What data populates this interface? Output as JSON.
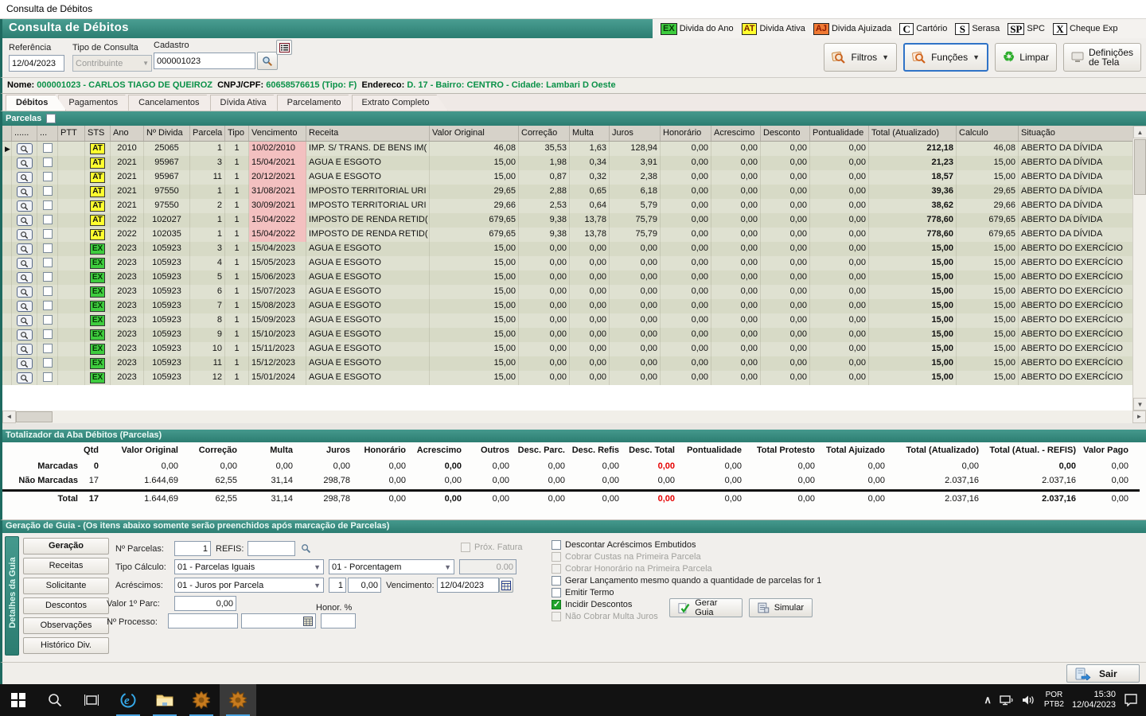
{
  "window": {
    "title": "Consulta de Débitos"
  },
  "header": {
    "title": "Consulta de Débitos",
    "legend": [
      {
        "badge": "EX",
        "label": "Divida do Ano",
        "bg": "#3ecc3e",
        "fg": "#073807",
        "plain": false
      },
      {
        "badge": "AT",
        "label": "Divida Ativa",
        "bg": "#ffff2e",
        "fg": "#7a1e00",
        "plain": false
      },
      {
        "badge": "AJ",
        "label": "Divida Ajuizada",
        "bg": "#f07a34",
        "fg": "#8f1a00",
        "plain": false
      },
      {
        "badge": "C",
        "label": "Cartório",
        "bg": "#ffffff",
        "fg": "#000000",
        "plain": true
      },
      {
        "badge": "S",
        "label": "Serasa",
        "bg": "#ffffff",
        "fg": "#000000",
        "plain": true
      },
      {
        "badge": "SP",
        "label": "SPC",
        "bg": "#ffffff",
        "fg": "#000000",
        "plain": true
      },
      {
        "badge": "X",
        "label": "Cheque Exp",
        "bg": "#ffffff",
        "fg": "#000000",
        "plain": true
      }
    ]
  },
  "filters": {
    "referencia_label": "Referência",
    "referencia_value": "12/04/2023",
    "tipo_consulta_label": "Tipo de Consulta",
    "tipo_consulta_value": "Contribuinte",
    "cadastro_label": "Cadastro",
    "cadastro_value": "000001023",
    "filtros_label": "Filtros",
    "funcoes_label": "Funções",
    "limpar_label": "Limpar",
    "definicoes_label_1": "Definições",
    "definicoes_label_2": "de Tela"
  },
  "taxpayer": {
    "nome_label": "Nome:",
    "nome_value": "000001023 - CARLOS TIAGO DE QUEIROZ",
    "cnpj_label": "CNPJ/CPF:",
    "cnpj_value": "60658576615 (Tipo: F)",
    "endereco_label": "Endereco:",
    "endereco_value": "D. 17 - Bairro: CENTRO - Cidade: Lambari D Oeste"
  },
  "tabs": [
    {
      "label": "Débitos",
      "active": true
    },
    {
      "label": "Pagamentos",
      "active": false
    },
    {
      "label": "Cancelamentos",
      "active": false
    },
    {
      "label": "Dívida Ativa",
      "active": false
    },
    {
      "label": "Parcelamento",
      "active": false
    },
    {
      "label": "Extrato Completo",
      "active": false
    }
  ],
  "parcelas_bar_label": "Parcelas",
  "table": {
    "columns": [
      "......",
      "...",
      "PTT",
      "STS",
      "Ano",
      "Nº Divida",
      "Parcela",
      "Tipo",
      "Vencimento",
      "Receita",
      "Valor Original",
      "Correção",
      "Multa",
      "Juros",
      "Honorário",
      "Acrescimo",
      "Desconto",
      "Pontualidade",
      "Total (Atualizado)",
      "Calculo",
      "Situação"
    ],
    "rows": [
      {
        "sts": "AT",
        "ano": "2010",
        "divida": "25065",
        "parcela": "1",
        "tipo": "1",
        "venc": "10/02/2010",
        "overdue": true,
        "receita": "IMP. S/ TRANS. DE BENS IM(",
        "vo": "46,08",
        "corr": "35,53",
        "multa": "1,63",
        "juros": "128,94",
        "hon": "0,00",
        "acr": "0,00",
        "desc": "0,00",
        "pont": "0,00",
        "total": "212,18",
        "calc": "46,08",
        "sit": "ABERTO DA DÍVIDA"
      },
      {
        "sts": "AT",
        "ano": "2021",
        "divida": "95967",
        "parcela": "3",
        "tipo": "1",
        "venc": "15/04/2021",
        "overdue": true,
        "receita": "AGUA E ESGOTO",
        "vo": "15,00",
        "corr": "1,98",
        "multa": "0,34",
        "juros": "3,91",
        "hon": "0,00",
        "acr": "0,00",
        "desc": "0,00",
        "pont": "0,00",
        "total": "21,23",
        "calc": "15,00",
        "sit": "ABERTO DA DÍVIDA"
      },
      {
        "sts": "AT",
        "ano": "2021",
        "divida": "95967",
        "parcela": "11",
        "tipo": "1",
        "venc": "20/12/2021",
        "overdue": true,
        "receita": "AGUA E ESGOTO",
        "vo": "15,00",
        "corr": "0,87",
        "multa": "0,32",
        "juros": "2,38",
        "hon": "0,00",
        "acr": "0,00",
        "desc": "0,00",
        "pont": "0,00",
        "total": "18,57",
        "calc": "15,00",
        "sit": "ABERTO DA DÍVIDA"
      },
      {
        "sts": "AT",
        "ano": "2021",
        "divida": "97550",
        "parcela": "1",
        "tipo": "1",
        "venc": "31/08/2021",
        "overdue": true,
        "receita": "IMPOSTO TERRITORIAL URI",
        "vo": "29,65",
        "corr": "2,88",
        "multa": "0,65",
        "juros": "6,18",
        "hon": "0,00",
        "acr": "0,00",
        "desc": "0,00",
        "pont": "0,00",
        "total": "39,36",
        "calc": "29,65",
        "sit": "ABERTO DA DÍVIDA"
      },
      {
        "sts": "AT",
        "ano": "2021",
        "divida": "97550",
        "parcela": "2",
        "tipo": "1",
        "venc": "30/09/2021",
        "overdue": true,
        "receita": "IMPOSTO TERRITORIAL URI",
        "vo": "29,66",
        "corr": "2,53",
        "multa": "0,64",
        "juros": "5,79",
        "hon": "0,00",
        "acr": "0,00",
        "desc": "0,00",
        "pont": "0,00",
        "total": "38,62",
        "calc": "29,66",
        "sit": "ABERTO DA DÍVIDA"
      },
      {
        "sts": "AT",
        "ano": "2022",
        "divida": "102027",
        "parcela": "1",
        "tipo": "1",
        "venc": "15/04/2022",
        "overdue": true,
        "receita": "IMPOSTO DE RENDA RETID(",
        "vo": "679,65",
        "corr": "9,38",
        "multa": "13,78",
        "juros": "75,79",
        "hon": "0,00",
        "acr": "0,00",
        "desc": "0,00",
        "pont": "0,00",
        "total": "778,60",
        "calc": "679,65",
        "sit": "ABERTO DA DÍVIDA"
      },
      {
        "sts": "AT",
        "ano": "2022",
        "divida": "102035",
        "parcela": "1",
        "tipo": "1",
        "venc": "15/04/2022",
        "overdue": true,
        "receita": "IMPOSTO DE RENDA RETID(",
        "vo": "679,65",
        "corr": "9,38",
        "multa": "13,78",
        "juros": "75,79",
        "hon": "0,00",
        "acr": "0,00",
        "desc": "0,00",
        "pont": "0,00",
        "total": "778,60",
        "calc": "679,65",
        "sit": "ABERTO DA DÍVIDA"
      },
      {
        "sts": "EX",
        "ano": "2023",
        "divida": "105923",
        "parcela": "3",
        "tipo": "1",
        "venc": "15/04/2023",
        "overdue": false,
        "receita": "AGUA E ESGOTO",
        "vo": "15,00",
        "corr": "0,00",
        "multa": "0,00",
        "juros": "0,00",
        "hon": "0,00",
        "acr": "0,00",
        "desc": "0,00",
        "pont": "0,00",
        "total": "15,00",
        "calc": "15,00",
        "sit": "ABERTO DO EXERCÍCIO"
      },
      {
        "sts": "EX",
        "ano": "2023",
        "divida": "105923",
        "parcela": "4",
        "tipo": "1",
        "venc": "15/05/2023",
        "overdue": false,
        "receita": "AGUA E ESGOTO",
        "vo": "15,00",
        "corr": "0,00",
        "multa": "0,00",
        "juros": "0,00",
        "hon": "0,00",
        "acr": "0,00",
        "desc": "0,00",
        "pont": "0,00",
        "total": "15,00",
        "calc": "15,00",
        "sit": "ABERTO DO EXERCÍCIO"
      },
      {
        "sts": "EX",
        "ano": "2023",
        "divida": "105923",
        "parcela": "5",
        "tipo": "1",
        "venc": "15/06/2023",
        "overdue": false,
        "receita": "AGUA E ESGOTO",
        "vo": "15,00",
        "corr": "0,00",
        "multa": "0,00",
        "juros": "0,00",
        "hon": "0,00",
        "acr": "0,00",
        "desc": "0,00",
        "pont": "0,00",
        "total": "15,00",
        "calc": "15,00",
        "sit": "ABERTO DO EXERCÍCIO"
      },
      {
        "sts": "EX",
        "ano": "2023",
        "divida": "105923",
        "parcela": "6",
        "tipo": "1",
        "venc": "15/07/2023",
        "overdue": false,
        "receita": "AGUA E ESGOTO",
        "vo": "15,00",
        "corr": "0,00",
        "multa": "0,00",
        "juros": "0,00",
        "hon": "0,00",
        "acr": "0,00",
        "desc": "0,00",
        "pont": "0,00",
        "total": "15,00",
        "calc": "15,00",
        "sit": "ABERTO DO EXERCÍCIO"
      },
      {
        "sts": "EX",
        "ano": "2023",
        "divida": "105923",
        "parcela": "7",
        "tipo": "1",
        "venc": "15/08/2023",
        "overdue": false,
        "receita": "AGUA E ESGOTO",
        "vo": "15,00",
        "corr": "0,00",
        "multa": "0,00",
        "juros": "0,00",
        "hon": "0,00",
        "acr": "0,00",
        "desc": "0,00",
        "pont": "0,00",
        "total": "15,00",
        "calc": "15,00",
        "sit": "ABERTO DO EXERCÍCIO"
      },
      {
        "sts": "EX",
        "ano": "2023",
        "divida": "105923",
        "parcela": "8",
        "tipo": "1",
        "venc": "15/09/2023",
        "overdue": false,
        "receita": "AGUA E ESGOTO",
        "vo": "15,00",
        "corr": "0,00",
        "multa": "0,00",
        "juros": "0,00",
        "hon": "0,00",
        "acr": "0,00",
        "desc": "0,00",
        "pont": "0,00",
        "total": "15,00",
        "calc": "15,00",
        "sit": "ABERTO DO EXERCÍCIO"
      },
      {
        "sts": "EX",
        "ano": "2023",
        "divida": "105923",
        "parcela": "9",
        "tipo": "1",
        "venc": "15/10/2023",
        "overdue": false,
        "receita": "AGUA E ESGOTO",
        "vo": "15,00",
        "corr": "0,00",
        "multa": "0,00",
        "juros": "0,00",
        "hon": "0,00",
        "acr": "0,00",
        "desc": "0,00",
        "pont": "0,00",
        "total": "15,00",
        "calc": "15,00",
        "sit": "ABERTO DO EXERCÍCIO"
      },
      {
        "sts": "EX",
        "ano": "2023",
        "divida": "105923",
        "parcela": "10",
        "tipo": "1",
        "venc": "15/11/2023",
        "overdue": false,
        "receita": "AGUA E ESGOTO",
        "vo": "15,00",
        "corr": "0,00",
        "multa": "0,00",
        "juros": "0,00",
        "hon": "0,00",
        "acr": "0,00",
        "desc": "0,00",
        "pont": "0,00",
        "total": "15,00",
        "calc": "15,00",
        "sit": "ABERTO DO EXERCÍCIO"
      },
      {
        "sts": "EX",
        "ano": "2023",
        "divida": "105923",
        "parcela": "11",
        "tipo": "1",
        "venc": "15/12/2023",
        "overdue": false,
        "receita": "AGUA E ESGOTO",
        "vo": "15,00",
        "corr": "0,00",
        "multa": "0,00",
        "juros": "0,00",
        "hon": "0,00",
        "acr": "0,00",
        "desc": "0,00",
        "pont": "0,00",
        "total": "15,00",
        "calc": "15,00",
        "sit": "ABERTO DO EXERCÍCIO"
      },
      {
        "sts": "EX",
        "ano": "2023",
        "divida": "105923",
        "parcela": "12",
        "tipo": "1",
        "venc": "15/01/2024",
        "overdue": false,
        "receita": "AGUA E ESGOTO",
        "vo": "15,00",
        "corr": "0,00",
        "multa": "0,00",
        "juros": "0,00",
        "hon": "0,00",
        "acr": "0,00",
        "desc": "0,00",
        "pont": "0,00",
        "total": "15,00",
        "calc": "15,00",
        "sit": "ABERTO DO EXERCÍCIO"
      }
    ]
  },
  "totalizer": {
    "bar_title": "Totalizador da Aba Débitos (Parcelas)",
    "columns": [
      "Qtd",
      "Valor Original",
      "Correção",
      "Multa",
      "Juros",
      "Honorário",
      "Acrescimo",
      "Outros",
      "Desc. Parc.",
      "Desc. Refis",
      "Desc. Total",
      "Pontualidade",
      "Total Protesto",
      "Total Ajuizado",
      "Total (Atualizado)",
      "Total (Atual. - REFIS)",
      "Valor Pago"
    ],
    "rows": [
      {
        "label": "Marcadas",
        "cells": [
          {
            "t": "0",
            "b": 1
          },
          {
            "t": "0,00"
          },
          {
            "t": "0,00"
          },
          {
            "t": "0,00"
          },
          {
            "t": "0,00"
          },
          {
            "t": "0,00"
          },
          {
            "t": "0,00",
            "b": 1
          },
          {
            "t": "0,00"
          },
          {
            "t": "0,00"
          },
          {
            "t": "0,00"
          },
          {
            "t": "0,00",
            "r": 1,
            "b": 1
          },
          {
            "t": "0,00"
          },
          {
            "t": "0,00"
          },
          {
            "t": "0,00"
          },
          {
            "t": "0,00"
          },
          {
            "t": "0,00",
            "b": 1
          },
          {
            "t": "0,00"
          }
        ]
      },
      {
        "label": "Não Marcadas",
        "cells": [
          {
            "t": "17"
          },
          {
            "t": "1.644,69"
          },
          {
            "t": "62,55"
          },
          {
            "t": "31,14"
          },
          {
            "t": "298,78"
          },
          {
            "t": "0,00"
          },
          {
            "t": "0,00"
          },
          {
            "t": "0,00"
          },
          {
            "t": "0,00"
          },
          {
            "t": "0,00"
          },
          {
            "t": "0,00"
          },
          {
            "t": "0,00"
          },
          {
            "t": "0,00"
          },
          {
            "t": "0,00"
          },
          {
            "t": "2.037,16"
          },
          {
            "t": "2.037,16"
          },
          {
            "t": "0,00"
          }
        ]
      },
      {
        "label": "Total",
        "cells": [
          {
            "t": "17",
            "b": 1
          },
          {
            "t": "1.644,69"
          },
          {
            "t": "62,55"
          },
          {
            "t": "31,14"
          },
          {
            "t": "298,78"
          },
          {
            "t": "0,00"
          },
          {
            "t": "0,00",
            "b": 1
          },
          {
            "t": "0,00"
          },
          {
            "t": "0,00"
          },
          {
            "t": "0,00"
          },
          {
            "t": "0,00",
            "r": 1,
            "b": 1
          },
          {
            "t": "0,00"
          },
          {
            "t": "0,00"
          },
          {
            "t": "0,00"
          },
          {
            "t": "2.037,16"
          },
          {
            "t": "2.037,16",
            "b": 1
          },
          {
            "t": "0,00"
          }
        ]
      }
    ]
  },
  "guide": {
    "bar_title": "Geração de Guia   -   (Os itens abaixo somente serão preenchidos após marcação de Parcelas)",
    "side_tab": "Detalhes da Guia",
    "nav_buttons": [
      "Geração",
      "Receitas",
      "Solicitante",
      "Descontos",
      "Observações",
      "Histórico Div."
    ],
    "num_parcelas_label": "Nº Parcelas:",
    "num_parcelas_value": "1",
    "refis_label": "REFIS:",
    "refis_value": "",
    "prox_fatura_label": "Próx. Fatura",
    "tipo_calculo_label": "Tipo Cálculo:",
    "tipo_calculo_value": "01 - Parcelas Iguais",
    "porcentagem_value": "01 - Porcentagem",
    "porcentagem_amount": "0.00",
    "acrescimos_label": "Acréscimos:",
    "acrescimos_value": "01 - Juros por Parcela",
    "acrescimos_n": "1",
    "acrescimos_v": "0,00",
    "vencimento_label": "Vencimento:",
    "vencimento_value": "12/04/2023",
    "valor1_label": "Valor 1º Parc:",
    "valor1_value": "0,00",
    "honor_label": "Honor. %",
    "processo_label": "Nº Processo:",
    "checkboxes": [
      {
        "label": "Descontar Acréscimos Embutidos",
        "checked": false,
        "disabled": false
      },
      {
        "label": "Cobrar Custas na Primeira Parcela",
        "checked": false,
        "disabled": true
      },
      {
        "label": "Cobrar Honorário na Primeira Parcela",
        "checked": false,
        "disabled": true
      },
      {
        "label": "Gerar Lançamento mesmo quando a quantidade de parcelas for 1",
        "checked": false,
        "disabled": false
      },
      {
        "label": "Emitir Termo",
        "checked": false,
        "disabled": false
      },
      {
        "label": "Incidir Descontos",
        "checked": true,
        "disabled": false
      },
      {
        "label": "Não Cobrar Multa Juros",
        "checked": false,
        "disabled": true
      }
    ],
    "gerar_label": "Gerar Guia",
    "simular_label": "Simular"
  },
  "bottom": {
    "sair_label": "Sair"
  },
  "taskbar": {
    "lang_top": "POR",
    "lang_bottom": "PTB2",
    "time": "15:30",
    "date": "12/04/2023"
  }
}
